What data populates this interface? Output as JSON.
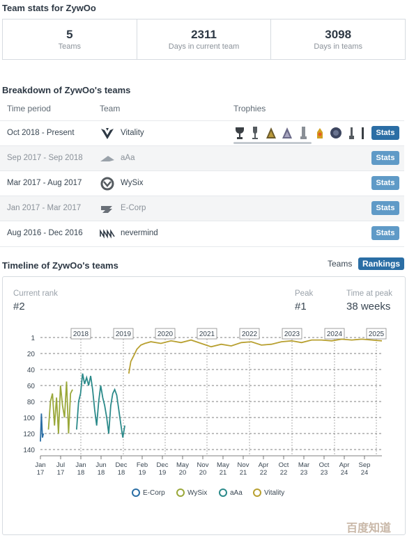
{
  "header": {
    "title": "Team stats for ZywOo"
  },
  "summary": [
    {
      "value": "5",
      "label": "Teams"
    },
    {
      "value": "2311",
      "label": "Days in current team"
    },
    {
      "value": "3098",
      "label": "Days in teams"
    }
  ],
  "breakdown": {
    "title": "Breakdown of ZywOo's teams",
    "columns": [
      "Time period",
      "Team",
      "Trophies"
    ],
    "stats_label": "Stats",
    "rows": [
      {
        "period": "Oct 2018 - Present",
        "team": "Vitality"
      },
      {
        "period": "Sep 2017 - Sep 2018",
        "team": "aAa"
      },
      {
        "period": "Mar 2017 - Aug 2017",
        "team": "WySix"
      },
      {
        "period": "Jan 2017 - Mar 2017",
        "team": "E-Corp"
      },
      {
        "period": "Aug 2016 - Dec 2016",
        "team": "nevermind"
      }
    ]
  },
  "timeline": {
    "title": "Timeline of ZywOo's teams",
    "tab_teams": "Teams",
    "tab_rankings": "Rankings",
    "current_rank_label": "Current rank",
    "current_rank_value": "#2",
    "peak_label": "Peak",
    "peak_value": "#1",
    "time_at_peak_label": "Time at peak",
    "time_at_peak_value": "38 weeks"
  },
  "chart_data": {
    "type": "line",
    "y_ticks": [
      "1",
      "20",
      "40",
      "60",
      "80",
      "100",
      "120",
      "140"
    ],
    "y_lim": [
      1,
      140
    ],
    "y_reversed": true,
    "year_markers": [
      "2018",
      "2019",
      "2020",
      "2021",
      "2022",
      "2023",
      "2024",
      "2025"
    ],
    "x_ticks": [
      [
        "Jan",
        "17"
      ],
      [
        "Jul",
        "17"
      ],
      [
        "Jan",
        "18"
      ],
      [
        "Jun",
        "18"
      ],
      [
        "Dec",
        "18"
      ],
      [
        "Feb",
        "19"
      ],
      [
        "Dec",
        "19"
      ],
      [
        "May",
        "20"
      ],
      [
        "Nov",
        "20"
      ],
      [
        "May",
        "21"
      ],
      [
        "Nov",
        "21"
      ],
      [
        "Apr",
        "22"
      ],
      [
        "Oct",
        "22"
      ],
      [
        "Mar",
        "23"
      ],
      [
        "Oct",
        "23"
      ],
      [
        "Apr",
        "24"
      ],
      [
        "Sep",
        "24"
      ]
    ],
    "series": [
      {
        "name": "E-Corp",
        "color": "#2b6ea5",
        "values": [
          [
            0.0,
            130
          ],
          [
            0.05,
            95
          ],
          [
            0.1,
            125
          ],
          [
            0.15,
            120
          ]
        ]
      },
      {
        "name": "WySix",
        "color": "#9aa83a",
        "values": [
          [
            0.4,
            115
          ],
          [
            0.5,
            80
          ],
          [
            0.6,
            70
          ],
          [
            0.7,
            110
          ],
          [
            0.8,
            75
          ],
          [
            0.9,
            120
          ],
          [
            1.0,
            60
          ],
          [
            1.1,
            85
          ],
          [
            1.2,
            100
          ],
          [
            1.3,
            55
          ],
          [
            1.4,
            120
          ],
          [
            1.5,
            70
          ],
          [
            1.6,
            65
          ]
        ]
      },
      {
        "name": "aAa",
        "color": "#2b8a8a",
        "values": [
          [
            1.8,
            115
          ],
          [
            1.9,
            80
          ],
          [
            2.0,
            70
          ],
          [
            2.1,
            45
          ],
          [
            2.2,
            58
          ],
          [
            2.3,
            50
          ],
          [
            2.4,
            60
          ],
          [
            2.5,
            48
          ],
          [
            2.6,
            65
          ],
          [
            2.7,
            90
          ],
          [
            2.8,
            110
          ],
          [
            2.9,
            80
          ],
          [
            3.0,
            60
          ],
          [
            3.1,
            75
          ],
          [
            3.2,
            85
          ],
          [
            3.3,
            100
          ],
          [
            3.4,
            120
          ],
          [
            3.5,
            85
          ],
          [
            3.6,
            70
          ],
          [
            3.7,
            65
          ],
          [
            3.8,
            72
          ],
          [
            3.9,
            90
          ],
          [
            4.0,
            108
          ],
          [
            4.1,
            125
          ],
          [
            4.2,
            110
          ]
        ]
      },
      {
        "name": "Vitality",
        "color": "#b8a030",
        "values": [
          [
            4.4,
            45
          ],
          [
            4.5,
            30
          ],
          [
            4.6,
            25
          ],
          [
            4.7,
            20
          ],
          [
            4.8,
            15
          ],
          [
            5.0,
            10
          ],
          [
            5.2,
            8
          ],
          [
            5.5,
            6
          ],
          [
            6.0,
            8
          ],
          [
            6.5,
            5
          ],
          [
            7.0,
            7
          ],
          [
            7.5,
            4
          ],
          [
            8.0,
            8
          ],
          [
            8.5,
            12
          ],
          [
            9.0,
            9
          ],
          [
            9.5,
            11
          ],
          [
            10.0,
            7
          ],
          [
            10.5,
            6
          ],
          [
            11.0,
            10
          ],
          [
            11.5,
            9
          ],
          [
            12.0,
            6
          ],
          [
            12.5,
            5
          ],
          [
            13.0,
            7
          ],
          [
            13.5,
            4
          ],
          [
            14.0,
            4
          ],
          [
            14.5,
            5
          ],
          [
            15.0,
            3
          ],
          [
            15.5,
            4
          ],
          [
            16.0,
            3
          ],
          [
            16.5,
            4
          ],
          [
            17.0,
            5
          ]
        ]
      }
    ]
  }
}
